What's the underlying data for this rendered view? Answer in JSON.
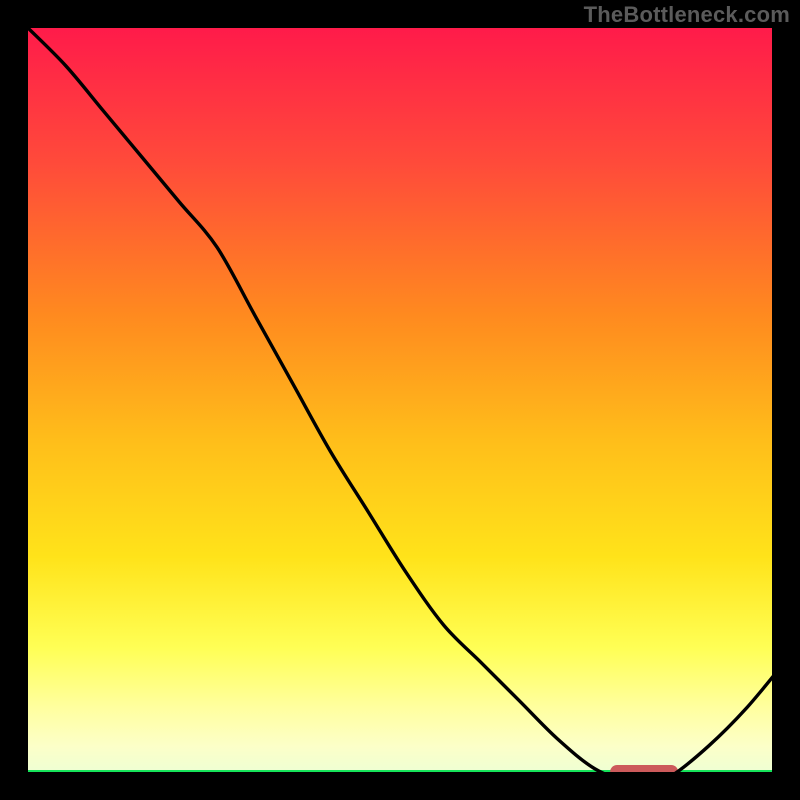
{
  "watermark": "TheBottleneck.com",
  "colors": {
    "frame": "#000000",
    "curve": "#000000",
    "green_band": "#16e35a",
    "highlight": "#cc5a5b",
    "gradient_top": "#ff1b4a",
    "gradient_mid1": "#ff8a1f",
    "gradient_mid2": "#ffd31a",
    "gradient_mid3": "#ffff55",
    "gradient_low": "#ffffb0",
    "gradient_near_bottom": "#f6ffce"
  },
  "chart_data": {
    "type": "line",
    "title": "",
    "xlabel": "",
    "ylabel": "",
    "xlim": [
      0,
      100
    ],
    "ylim": [
      0,
      100
    ],
    "x": [
      0,
      5,
      10,
      15,
      20,
      25,
      30,
      35,
      40,
      45,
      50,
      55,
      60,
      65,
      70,
      75,
      80,
      82,
      85,
      90,
      95,
      100
    ],
    "values": [
      100,
      95,
      89,
      83,
      77,
      71,
      62,
      53,
      44,
      36,
      28,
      21,
      16,
      11,
      6,
      2,
      0,
      0,
      1,
      5,
      10,
      16
    ],
    "highlight_band_x": [
      77,
      86
    ],
    "notes": "Values are relative percentages read from the plot area. The curve starts at the top-left (100%), descends through a slight knee around x≈25–30, reaches a flat minimum (~0) around x≈77–86 where a red highlight bar sits on the baseline, then rises toward the right edge (~16% at x=100). A thin green band runs along the very bottom of the plot."
  }
}
